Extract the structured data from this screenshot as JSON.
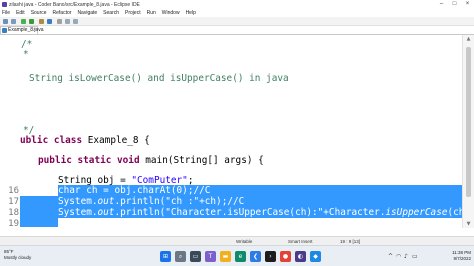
{
  "window": {
    "title": "zilashi java - Coder Bano/src/Example_8.java - Eclipse IDE"
  },
  "menu": [
    "File",
    "Edit",
    "Source",
    "Refactor",
    "Navigate",
    "Search",
    "Project",
    "Run",
    "Window",
    "Help"
  ],
  "editor_tab": {
    "label": "Example_8.java"
  },
  "lines": {
    "l1": "/*",
    "l2": "*",
    "l3": "String isLowerCase() and isUpperCase() in java",
    "l4": "*/",
    "l5_kw": "ublic class",
    "l5_rest": " Example_8 {",
    "l6_kw": "public static void",
    "l6_rest": " main(String[] args) {",
    "l7_type": "String obj = ",
    "l7_str": "\"ComPuter\"",
    "l7_end": ";",
    "l8": "char ch = obj.charAt(0);//C",
    "l9_a": "System.",
    "l9_out": "out",
    "l9_b": ".println(\"ch :\"+ch);//C",
    "l10_a": "System.",
    "l10_out": "out",
    "l10_b": ".println(\"Character.isUpperCase(ch):\"+Character.",
    "l10_it": "isUpperCase",
    "l10_c": "(ch));//true"
  },
  "line_numbers": [
    "16",
    "17",
    "18",
    "19"
  ],
  "status": {
    "mode": "Writable",
    "insert": "Smart Insert",
    "position": "19 : 9 [13]"
  },
  "taskbar": {
    "temperature": "85°F",
    "weather": "Mostly cloudy",
    "time": "11:38 PM",
    "date": "9/7/2022"
  }
}
